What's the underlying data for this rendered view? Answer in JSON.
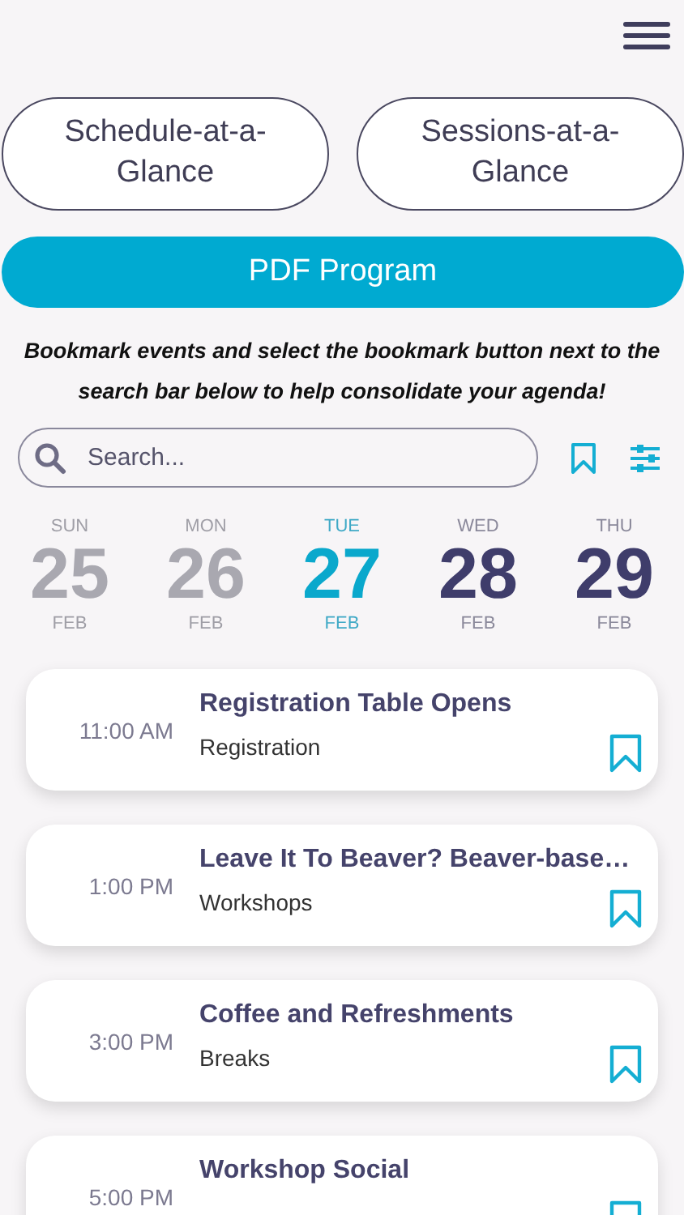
{
  "nav_buttons": [
    {
      "label": "Schedule-at-a-Glance"
    },
    {
      "label": "Sessions-at-a-Glance"
    }
  ],
  "pdf_button": {
    "label": "PDF Program"
  },
  "instructions": "Bookmark events and select the bookmark button next to the search bar below to help consolidate your agenda!",
  "search": {
    "placeholder": "Search..."
  },
  "bookmark_filter": {
    "on": false
  },
  "days": [
    {
      "weekday": "SUN",
      "day": "25",
      "month": "FEB",
      "selected": false,
      "disabled": true
    },
    {
      "weekday": "MON",
      "day": "26",
      "month": "FEB",
      "selected": false,
      "disabled": true
    },
    {
      "weekday": "TUE",
      "day": "27",
      "month": "FEB",
      "selected": true,
      "disabled": false
    },
    {
      "weekday": "WED",
      "day": "28",
      "month": "FEB",
      "selected": false,
      "disabled": false
    },
    {
      "weekday": "THU",
      "day": "29",
      "month": "FEB",
      "selected": false,
      "disabled": false
    }
  ],
  "events": [
    {
      "time": "11:00 AM",
      "title": "Registration Table Opens",
      "category": "Registration",
      "bookmarked": false
    },
    {
      "time": "1:00 PM",
      "title": "Leave It To Beaver? Beaver-base…",
      "category": "Workshops",
      "bookmarked": false
    },
    {
      "time": "3:00 PM",
      "title": "Coffee and Refreshments",
      "category": "Breaks",
      "bookmarked": false
    },
    {
      "time": "5:00 PM",
      "title": "Workshop Social",
      "bookmarked": false
    }
  ]
}
